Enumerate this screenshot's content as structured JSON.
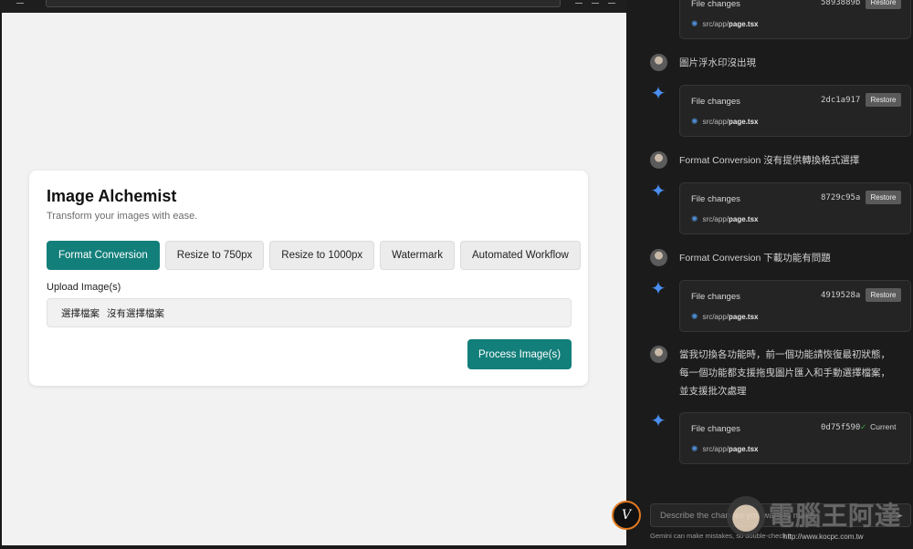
{
  "preview": {
    "card": {
      "title": "Image Alchemist",
      "subtitle": "Transform your images with ease.",
      "tabs": [
        {
          "label": "Format Conversion",
          "active": true
        },
        {
          "label": "Resize to 750px",
          "active": false
        },
        {
          "label": "Resize to 1000px",
          "active": false
        },
        {
          "label": "Watermark",
          "active": false
        },
        {
          "label": "Automated Workflow",
          "active": false
        }
      ],
      "upload_label": "Upload Image(s)",
      "file_input": {
        "choose_label": "選擇檔案",
        "status": "沒有選擇檔案"
      },
      "process_label": "Process Image(s)"
    },
    "accent_color": "#137f7a"
  },
  "chat": {
    "file_cards": [
      {
        "title": "File changes",
        "hash": "5893889b",
        "action": "Restore",
        "file_dir": "src/app/",
        "file_name": "page.tsx"
      },
      {
        "title": "File changes",
        "hash": "2dc1a917",
        "action": "Restore",
        "file_dir": "src/app/",
        "file_name": "page.tsx"
      },
      {
        "title": "File changes",
        "hash": "8729c95a",
        "action": "Restore",
        "file_dir": "src/app/",
        "file_name": "page.tsx"
      },
      {
        "title": "File changes",
        "hash": "4919528a",
        "action": "Restore",
        "file_dir": "src/app/",
        "file_name": "page.tsx"
      },
      {
        "title": "File changes",
        "hash": "0d75f590",
        "action": "Current",
        "file_dir": "src/app/",
        "file_name": "page.tsx"
      }
    ],
    "user_messages": [
      {
        "lines": [
          "圖片浮水印沒出現"
        ]
      },
      {
        "lines": [
          "Format Conversion 沒有提供轉換格式選擇"
        ]
      },
      {
        "lines": [
          "Format Conversion 下載功能有問題"
        ]
      },
      {
        "lines": [
          "當我切換各功能時，前一個功能請恢復最初狀態，",
          "每一個功能都支援拖曳圖片匯入和手動選擇檔案，",
          "並支援批次處理"
        ]
      }
    ],
    "input_placeholder": "Describe the changes you want to make",
    "disclaimer": "Gemini can make mistakes, so double-check it"
  },
  "watermark": {
    "text": "電腦王阿達",
    "url": "http://www.kocpc.com.tw"
  },
  "icons": {
    "gemini": "gemini-sparkle-icon",
    "file": "react-file-icon",
    "check": "check-icon",
    "send": "send-icon"
  },
  "colors": {
    "gemini_blue": "#4a8ef0",
    "check_green": "#41a64a",
    "chat_bg": "#1b1b1b"
  }
}
